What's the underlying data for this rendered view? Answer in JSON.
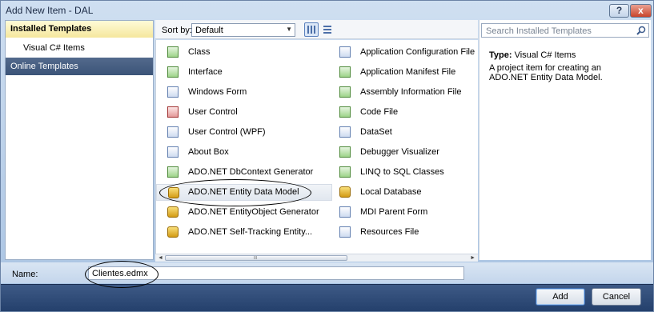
{
  "window": {
    "title": "Add New Item - DAL",
    "help_label": "?",
    "close_label": "x"
  },
  "nav": {
    "installed_label": "Installed Templates",
    "visual_csharp_label": "Visual C# Items",
    "online_label": "Online Templates"
  },
  "sortbar": {
    "sort_label": "Sort by:",
    "sort_value": "Default",
    "sort_arrow": "▼"
  },
  "templates_left": [
    {
      "label": "Class",
      "icon": "class-icon"
    },
    {
      "label": "Interface",
      "icon": "interface-icon"
    },
    {
      "label": "Windows Form",
      "icon": "windows-form-icon"
    },
    {
      "label": "User Control",
      "icon": "user-control-icon"
    },
    {
      "label": "User Control (WPF)",
      "icon": "user-control-wpf-icon"
    },
    {
      "label": "About Box",
      "icon": "about-box-icon"
    },
    {
      "label": "ADO.NET DbContext Generator",
      "icon": "dbcontext-generator-icon"
    },
    {
      "label": "ADO.NET Entity Data Model",
      "icon": "entity-data-model-icon"
    },
    {
      "label": "ADO.NET EntityObject Generator",
      "icon": "entityobject-generator-icon"
    },
    {
      "label": "ADO.NET Self-Tracking Entity...",
      "icon": "self-tracking-entity-icon"
    }
  ],
  "templates_right": [
    {
      "label": "Application Configuration File",
      "icon": "config-file-icon"
    },
    {
      "label": "Application Manifest File",
      "icon": "manifest-file-icon"
    },
    {
      "label": "Assembly Information File",
      "icon": "assembly-info-icon"
    },
    {
      "label": "Code File",
      "icon": "code-file-icon"
    },
    {
      "label": "DataSet",
      "icon": "dataset-icon"
    },
    {
      "label": "Debugger Visualizer",
      "icon": "debugger-visualizer-icon"
    },
    {
      "label": "LINQ to SQL Classes",
      "icon": "linq-to-sql-icon"
    },
    {
      "label": "Local Database",
      "icon": "local-database-icon"
    },
    {
      "label": "MDI Parent Form",
      "icon": "mdi-parent-form-icon"
    },
    {
      "label": "Resources File",
      "icon": "resources-file-icon"
    }
  ],
  "scrollbar": {
    "left_arrow": "◄",
    "right_arrow": "►",
    "grip": "III"
  },
  "details": {
    "search_placeholder": "Search Installed Templates",
    "type_label": "Type:",
    "type_value": "Visual C# Items",
    "description": "A project item for creating an ADO.NET Entity Data Model."
  },
  "name_row": {
    "label": "Name:",
    "value": "Clientes.edmx"
  },
  "footer": {
    "add_label": "Add",
    "cancel_label": "Cancel"
  },
  "colors": {
    "selected_nav": "#3b5478",
    "footer": "#24406c",
    "installed_header": "#f5e79d"
  }
}
